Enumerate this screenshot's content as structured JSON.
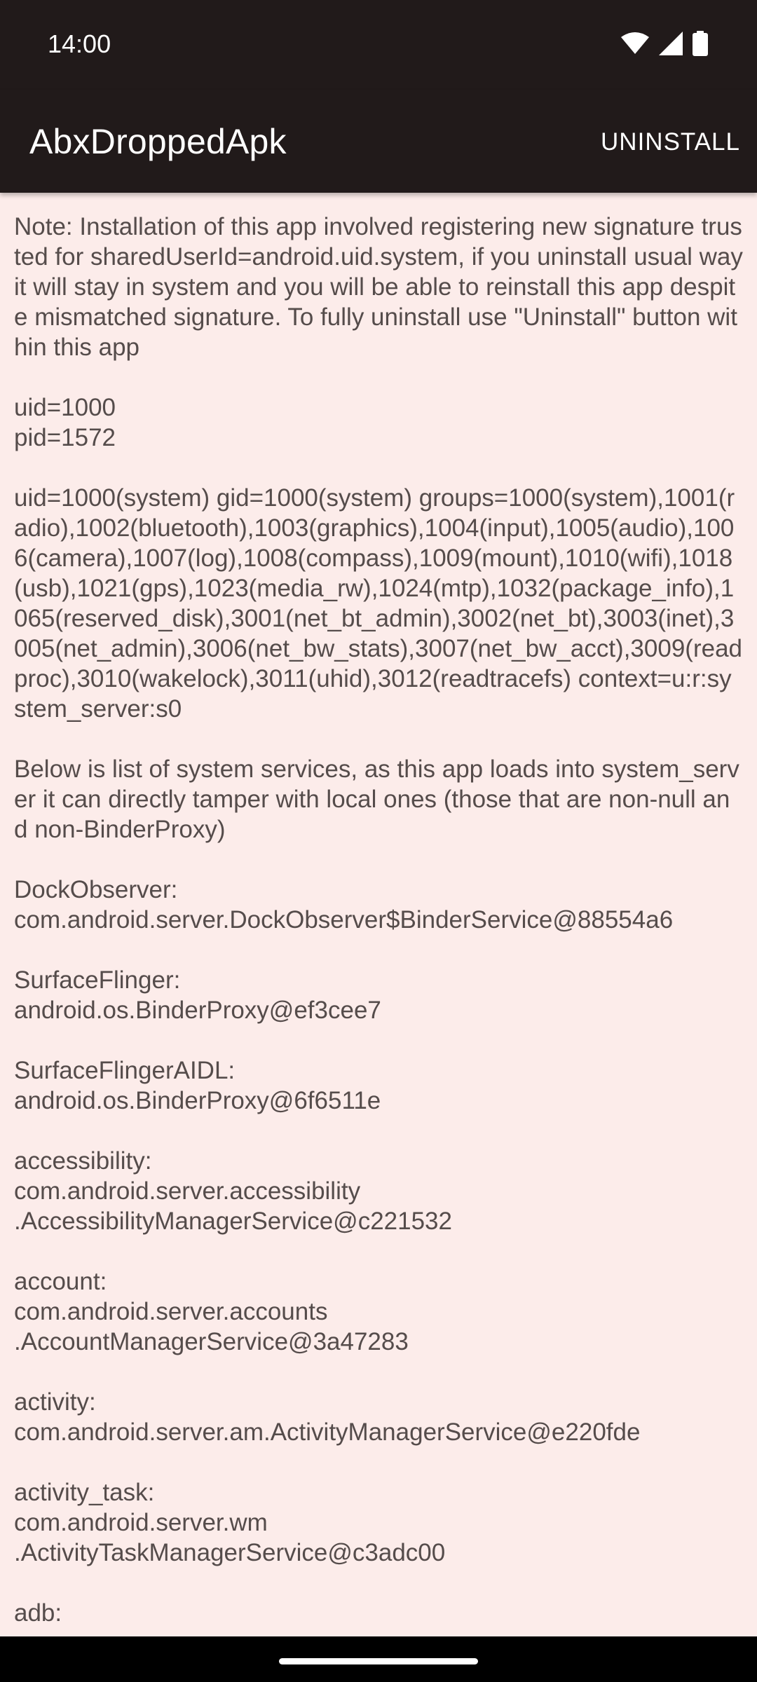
{
  "status_bar": {
    "time": "14:00",
    "icons": [
      "wifi-icon",
      "cellular-signal-icon",
      "battery-icon"
    ]
  },
  "app_bar": {
    "title": "AbxDroppedApk",
    "uninstall_label": "UNINSTALL"
  },
  "content": {
    "text": "Note: Installation of this app involved registering new signature trusted for sharedUserId=android.uid.system, if you uninstall usual way it will stay in system and you will be able to reinstall this app despite mismatched signature. To fully uninstall use \"Uninstall\" button within this app\n\nuid=1000\npid=1572\n\nuid=1000(system) gid=1000(system) groups=1000(system),1001(radio),1002(bluetooth),1003(graphics),1004(input),1005(audio),1006(camera),1007(log),1008(compass),1009(mount),1010(wifi),1018(usb),1021(gps),1023(media_rw),1024(mtp),1032(package_info),1065(reserved_disk),3001(net_bt_admin),3002(net_bt),3003(inet),3005(net_admin),3006(net_bw_stats),3007(net_bw_acct),3009(readproc),3010(wakelock),3011(uhid),3012(readtracefs) context=u:r:system_server:s0\n\nBelow is list of system services, as this app loads into system_server it can directly tamper with local ones (those that are non-null and non-BinderProxy)\n\nDockObserver:\ncom.android.server.DockObserver$BinderService@88554a6\n\nSurfaceFlinger:\nandroid.os.BinderProxy@ef3cee7\n\nSurfaceFlingerAIDL:\nandroid.os.BinderProxy@6f6511e\n\naccessibility:\ncom.android.server.accessibility\n.AccessibilityManagerService@c221532\n\naccount:\ncom.android.server.accounts\n.AccountManagerService@3a47283\n\nactivity:\ncom.android.server.am.ActivityManagerService@e220fde\n\nactivity_task:\ncom.android.server.wm\n.ActivityTaskManagerService@c3adc00\n\nadb:"
  },
  "colors": {
    "bar_background": "#211a1a",
    "content_background": "#fcecea",
    "text_color": "#554c4b"
  }
}
